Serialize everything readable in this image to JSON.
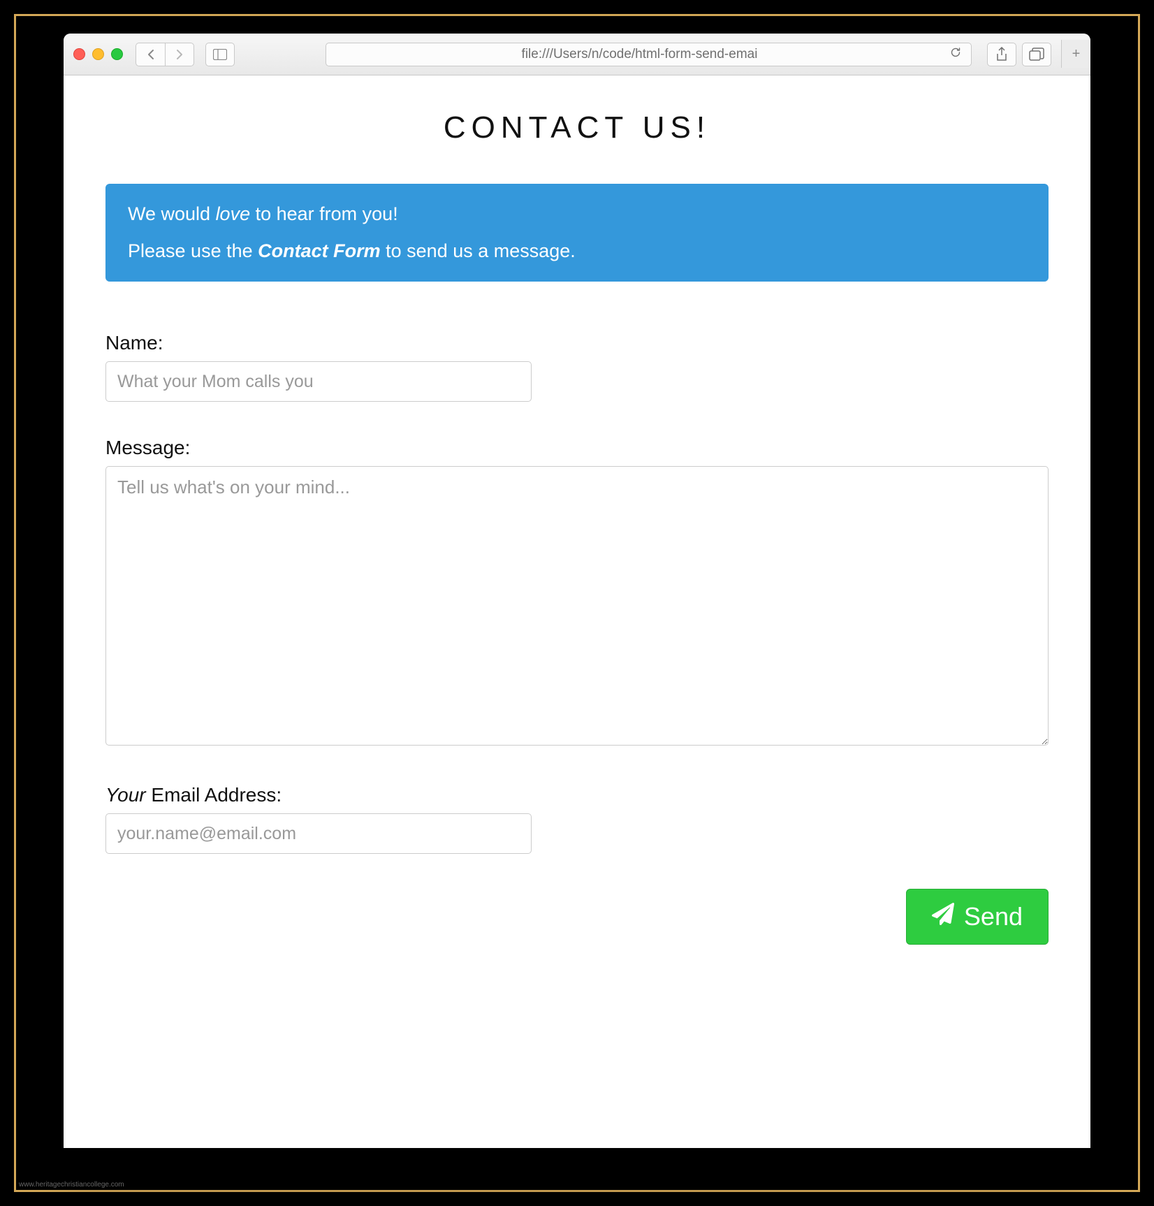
{
  "browser": {
    "address": "file:///Users/n/code/html-form-send-emai"
  },
  "page": {
    "title": "CONTACT US!",
    "info": {
      "line1_pre": "We would ",
      "line1_italic": "love",
      "line1_post": " to hear from you!",
      "line2_pre": "Please use the ",
      "line2_bold": "Contact Form",
      "line2_post": " to send us a message."
    },
    "form": {
      "name_label": "Name:",
      "name_placeholder": "What your Mom calls you",
      "message_label": "Message:",
      "message_placeholder": "Tell us what's on your mind...",
      "email_label_italic": "Your",
      "email_label_rest": " Email Address:",
      "email_placeholder": "your.name@email.com",
      "send_label": "Send"
    }
  },
  "watermark": "www.heritagechristiancollege.com"
}
